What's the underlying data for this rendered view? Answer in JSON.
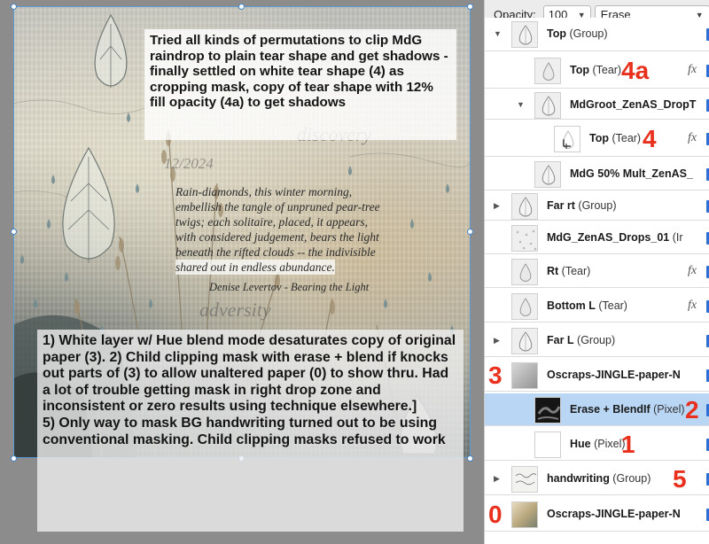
{
  "panel": {
    "opacity_label": "Opacity:",
    "opacity_value": "100",
    "blend_mode": "Erase",
    "layers": [
      {
        "id": "top-group",
        "indent": 0,
        "expand": "open",
        "name": "Top",
        "type": "(Group)",
        "thumb": "drop",
        "fx": "",
        "anno": ""
      },
      {
        "id": "top-tear-1",
        "indent": 1,
        "expand": "none",
        "name": "Top",
        "type": "(Tear)",
        "thumb": "tear",
        "fx": "fx",
        "anno": "4a"
      },
      {
        "id": "mdgroot",
        "indent": 1,
        "expand": "open",
        "name": "MdGroot_ZenAS_DropT",
        "type": "",
        "thumb": "drop",
        "fx": "",
        "anno": ""
      },
      {
        "id": "top-tear-2",
        "indent": 2,
        "expand": "none",
        "name": "Top",
        "type": "(Tear)",
        "thumb": "tear-white",
        "fx": "fx",
        "anno": "4"
      },
      {
        "id": "mdg-50",
        "indent": 1,
        "expand": "none",
        "name": "MdG 50% Mult_ZenAS_",
        "type": "",
        "thumb": "drop",
        "fx": "",
        "anno": ""
      },
      {
        "id": "far-rt",
        "indent": 0,
        "expand": "closed",
        "name": "Far rt",
        "type": "(Group)",
        "thumb": "drop",
        "fx": "",
        "anno": ""
      },
      {
        "id": "mdg-drops",
        "indent": 0,
        "expand": "none",
        "name": "MdG_ZenAS_Drops_01",
        "type": "(Ir",
        "thumb": "dots",
        "fx": "",
        "anno": ""
      },
      {
        "id": "rt-tear",
        "indent": 0,
        "expand": "none",
        "name": "Rt",
        "type": "(Tear)",
        "thumb": "tear",
        "fx": "fx",
        "anno": ""
      },
      {
        "id": "bottom-l",
        "indent": 0,
        "expand": "none",
        "name": "Bottom L",
        "type": "(Tear)",
        "thumb": "tear",
        "fx": "fx",
        "anno": ""
      },
      {
        "id": "far-l",
        "indent": 0,
        "expand": "closed",
        "name": "Far L",
        "type": "(Group)",
        "thumb": "drop",
        "fx": "",
        "anno": ""
      },
      {
        "id": "oscraps-1",
        "indent": 0,
        "expand": "none",
        "name": "Oscraps-JINGLE-paper-N",
        "type": "",
        "thumb": "paper-grey",
        "fx": "",
        "anno": "3"
      },
      {
        "id": "erase-blend",
        "indent": 1,
        "expand": "none",
        "name": "Erase + BlendIf",
        "type": "(Pixel)",
        "thumb": "mask",
        "fx": "",
        "anno": "2",
        "selected": true
      },
      {
        "id": "hue",
        "indent": 1,
        "expand": "none",
        "name": "Hue",
        "type": "(Pixel)",
        "thumb": "white",
        "fx": "",
        "anno": "1"
      },
      {
        "id": "handwriting",
        "indent": 0,
        "expand": "closed",
        "name": "handwriting",
        "type": "(Group)",
        "thumb": "handwriting",
        "fx": "",
        "anno": "5"
      },
      {
        "id": "oscraps-0",
        "indent": 0,
        "expand": "none",
        "name": "Oscraps-JINGLE-paper-N",
        "type": "",
        "thumb": "paper-color",
        "fx": "",
        "anno": "0"
      }
    ]
  },
  "canvas": {
    "note_top": "Tried all kinds of permutations to clip MdG raindrop to plain tear shape and get shadows - finally settled on white tear shape (4) as cropping mask, copy of tear shape with 12% fill opacity (4a) to get shadows",
    "poem_lines": [
      "Rain-diamonds, this winter morning,",
      "embellish the tangle of unpruned pear-tree",
      "twigs; each solitaire, placed, it appears,",
      "with considered judgement, bears the light",
      "beneath the rifted clouds -- the indivisible",
      "shared out in endless abundance."
    ],
    "poem_attribution": "Denise Levertov  - Bearing the Light",
    "artwork_words": [
      "discovery",
      "adversity",
      "12/2024"
    ],
    "note_bottom_1": "1) White layer w/ Hue blend mode desaturates copy of original paper (3).  2) Child clipping mask with erase + blend if knocks out parts of (3) to allow unaltered paper (0) to show thru. Had a lot of trouble getting mask in right drop zone and inconsistent or zero results using technique elsewhere.]",
    "note_bottom_2": "5) Only way to mask BG handwriting turned out to be using conventional masking. Child clipping masks refused to work"
  },
  "colors": {
    "annotation": "#e8301d",
    "selection": "#b9d6f5",
    "handle": "#4a86c5"
  },
  "icons": {
    "collapse-open": "▼",
    "collapse-closed": "▶",
    "dropdown": "chevron-down-icon",
    "effects": "fx-icon",
    "visibility": "visibility-icon"
  }
}
